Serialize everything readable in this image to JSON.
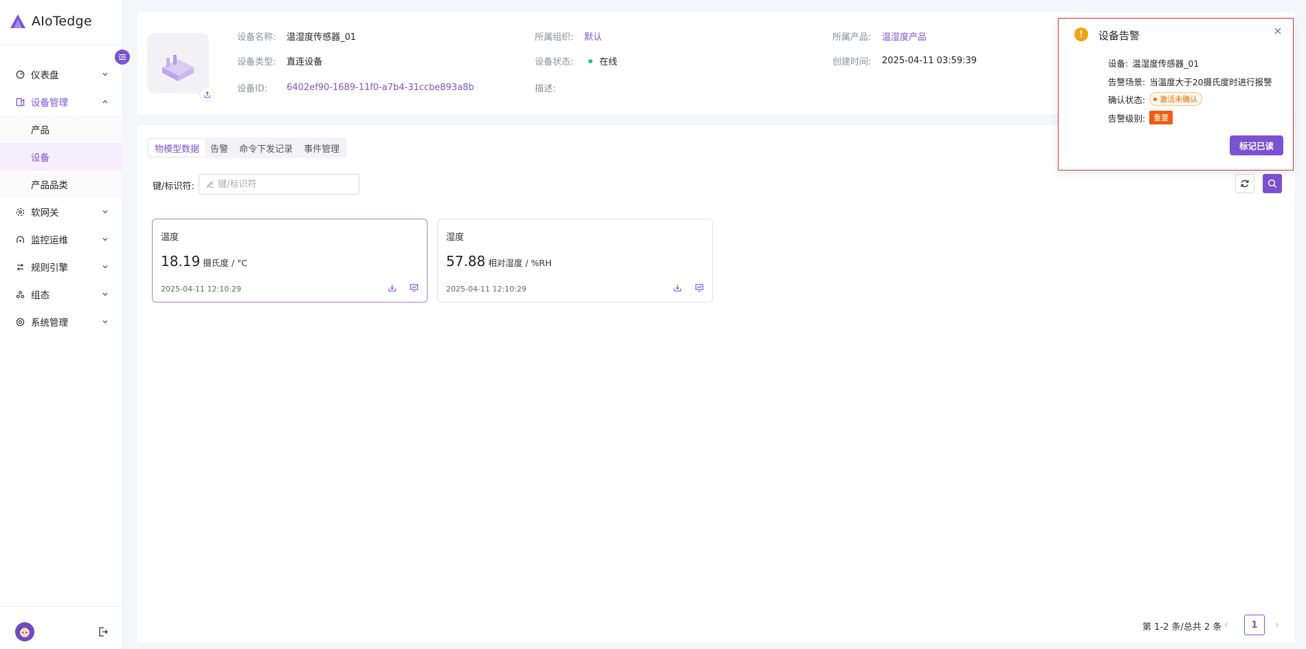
{
  "app": {
    "name": "AIoTedge"
  },
  "sidebar": {
    "items": [
      {
        "label": "仪表盘",
        "icon": "dashboard-icon",
        "expanded": false
      },
      {
        "label": "设备管理",
        "icon": "device-manage-icon",
        "expanded": true,
        "children": [
          {
            "label": "产品"
          },
          {
            "label": "设备",
            "active": true
          },
          {
            "label": "产品品类"
          }
        ]
      },
      {
        "label": "软网关",
        "icon": "gateway-icon",
        "expanded": false
      },
      {
        "label": "监控运维",
        "icon": "monitor-icon",
        "expanded": false
      },
      {
        "label": "规则引擎",
        "icon": "rule-engine-icon",
        "expanded": false
      },
      {
        "label": "组态",
        "icon": "config-icon",
        "expanded": false
      },
      {
        "label": "系统管理",
        "icon": "settings-icon",
        "expanded": false
      }
    ]
  },
  "device": {
    "name_label": "设备名称:",
    "name": "温湿度传感器_01",
    "org_label": "所属组织:",
    "org": "默认",
    "product_label": "所属产品:",
    "product": "温湿度产品",
    "type_label": "设备类型:",
    "type": "直连设备",
    "status_label": "设备状态:",
    "status": "在线",
    "created_label": "创建时间:",
    "created": "2025-04-11 03:59:39",
    "id_label": "设备ID:",
    "id": "6402ef90-1689-11f0-a7b4-31ccbe893a8b",
    "desc_label": "描述:",
    "desc": ""
  },
  "tabs": [
    "物模型数据",
    "告警",
    "命令下发记录",
    "事件管理"
  ],
  "filter": {
    "label": "键/标识符:",
    "placeholder": "键/标识符"
  },
  "properties": [
    {
      "name": "温度",
      "value": "18.19",
      "unit": "摄氏度 / °C",
      "time": "2025-04-11 12:10:29"
    },
    {
      "name": "湿度",
      "value": "57.88",
      "unit": "相对湿度 / %RH",
      "time": "2025-04-11 12:10:29"
    }
  ],
  "pagination": {
    "info": "第 1-2 条/总共 2 条",
    "current": "1"
  },
  "notification": {
    "title": "设备告警",
    "device_label": "设备:",
    "device": "温湿度传感器_01",
    "scene_label": "告警场景:",
    "scene": "当温度大于20摄氏度时进行报警",
    "confirm_label": "确认状态:",
    "confirm": "激活未确认",
    "level_label": "告警级别:",
    "level": "重要",
    "mark_read": "标记已读"
  },
  "colors": {
    "accent": "#7d52d0",
    "online": "#19c29a",
    "warning": "#f2a40e",
    "level_important": "#ef5c12"
  }
}
